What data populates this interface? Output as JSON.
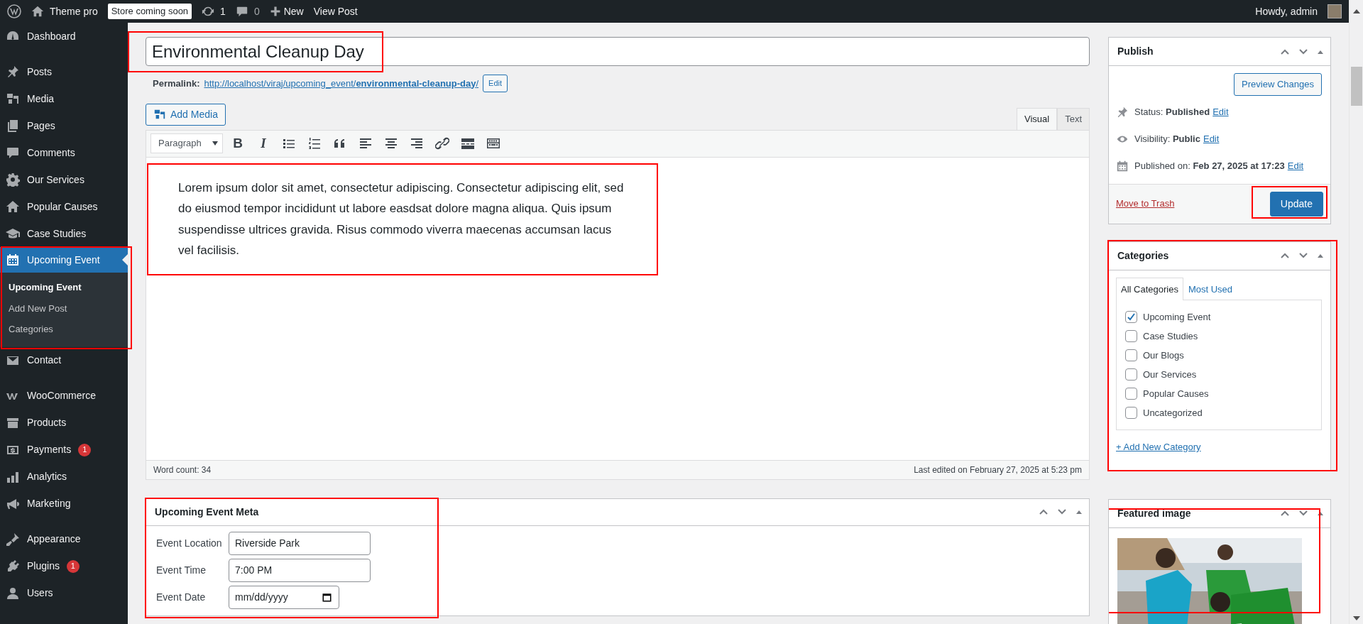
{
  "admin_bar": {
    "site_name": "Theme pro",
    "store_badge": "Store coming soon",
    "updates_count": "1",
    "comments_count": "0",
    "new_label": "New",
    "view_post": "View Post",
    "greeting": "Howdy, admin"
  },
  "sidebar": {
    "groups": [
      [
        {
          "label": "Dashboard",
          "kind": "dashboard",
          "selected": false
        }
      ],
      [
        {
          "label": "Posts",
          "kind": "pin",
          "selected": false
        },
        {
          "label": "Media",
          "kind": "media",
          "selected": false
        },
        {
          "label": "Pages",
          "kind": "pages",
          "selected": false
        },
        {
          "label": "Comments",
          "kind": "comment",
          "selected": false
        },
        {
          "label": "Our Services",
          "kind": "gear",
          "selected": false
        },
        {
          "label": "Popular Causes",
          "kind": "home",
          "selected": false
        },
        {
          "label": "Case Studies",
          "kind": "cap",
          "selected": false
        },
        {
          "label": "Upcoming Event",
          "kind": "calendar",
          "selected": true,
          "highlighted": true,
          "children": [
            {
              "label": "Upcoming Event",
              "selected": true
            },
            {
              "label": "Add New Post",
              "selected": false
            },
            {
              "label": "Categories",
              "selected": false
            }
          ]
        },
        {
          "label": "Contact",
          "kind": "mail",
          "selected": false
        }
      ],
      [
        {
          "label": "WooCommerce",
          "kind": "woo",
          "selected": false
        },
        {
          "label": "Products",
          "kind": "archive",
          "selected": false
        },
        {
          "label": "Payments",
          "kind": "dollar",
          "selected": false,
          "badge": "1"
        },
        {
          "label": "Analytics",
          "kind": "chart",
          "selected": false
        },
        {
          "label": "Marketing",
          "kind": "megaphone",
          "selected": false
        }
      ],
      [
        {
          "label": "Appearance",
          "kind": "brush",
          "selected": false
        },
        {
          "label": "Plugins",
          "kind": "plug",
          "selected": false,
          "badge": "1"
        },
        {
          "label": "Users",
          "kind": "user",
          "selected": false
        }
      ]
    ]
  },
  "editor": {
    "title": "Environmental Cleanup Day",
    "title_highlighted": true,
    "permalink": {
      "label": "Permalink:",
      "url": "http://localhost/viraj/upcoming_event/**environmental-cleanup-day**/",
      "edit": "Edit"
    },
    "add_media": "Add Media",
    "tabs": [
      {
        "label": "Visual",
        "selected": true
      },
      {
        "label": "Text",
        "selected": false
      }
    ],
    "format": "Paragraph",
    "toolbar": [
      {
        "kind": "bold",
        "glyph": "B"
      },
      {
        "kind": "italic",
        "glyph": "I"
      },
      {
        "kind": "bullet-list"
      },
      {
        "kind": "numbered-list"
      },
      {
        "kind": "quote"
      },
      {
        "kind": "align-left"
      },
      {
        "kind": "align-center"
      },
      {
        "kind": "align-right"
      },
      {
        "kind": "link"
      },
      {
        "kind": "more"
      },
      {
        "kind": "toolbar-toggle"
      }
    ],
    "content": "Lorem ipsum dolor sit amet, consectetur adipiscing. Consectetur adipiscing elit, sed do eiusmod tempor incididunt ut labore easdsat dolore magna aliqua. Quis ipsum suspendisse ultrices gravida. Risus commodo viverra maecenas accumsan lacus vel facilisis.",
    "content_highlighted": true,
    "word_count": "Word count: 34",
    "last_edited": "Last edited on February 27, 2025 at 5:23 pm"
  },
  "event_meta": {
    "title": "Upcoming Event Meta",
    "highlighted": true,
    "fields": [
      {
        "label": "Event Location",
        "kind": "text",
        "value": "Riverside Park"
      },
      {
        "label": "Event Time",
        "kind": "text",
        "value": "7:00 PM"
      },
      {
        "label": "Event Date",
        "kind": "date",
        "placeholder": "mm/dd/yyyy"
      }
    ]
  },
  "publish": {
    "title": "Publish",
    "preview": "Preview Changes",
    "rows": [
      {
        "kind": "pin",
        "text": "Status: **Published**",
        "edit": "Edit"
      },
      {
        "kind": "eye",
        "text": "Visibility: **Public**",
        "edit": "Edit"
      },
      {
        "kind": "calendar",
        "text": "Published on: **Feb 27, 2025 at 17:23**",
        "edit": "Edit"
      }
    ],
    "trash": "Move to Trash",
    "update": "Update",
    "update_highlighted": true
  },
  "categories": {
    "title": "Categories",
    "highlighted": true,
    "tabs": [
      {
        "label": "All Categories",
        "selected": true
      },
      {
        "label": "Most Used",
        "selected": false
      }
    ],
    "items": [
      {
        "label": "Upcoming Event",
        "checked": true
      },
      {
        "label": "Case Studies",
        "checked": false
      },
      {
        "label": "Our Blogs",
        "checked": false
      },
      {
        "label": "Our Services",
        "checked": false
      },
      {
        "label": "Popular Causes",
        "checked": false
      },
      {
        "label": "Uncategorized",
        "checked": false
      }
    ],
    "add_new": "+ Add New Category"
  },
  "featured_image": {
    "title": "Featured image",
    "highlighted": true
  }
}
